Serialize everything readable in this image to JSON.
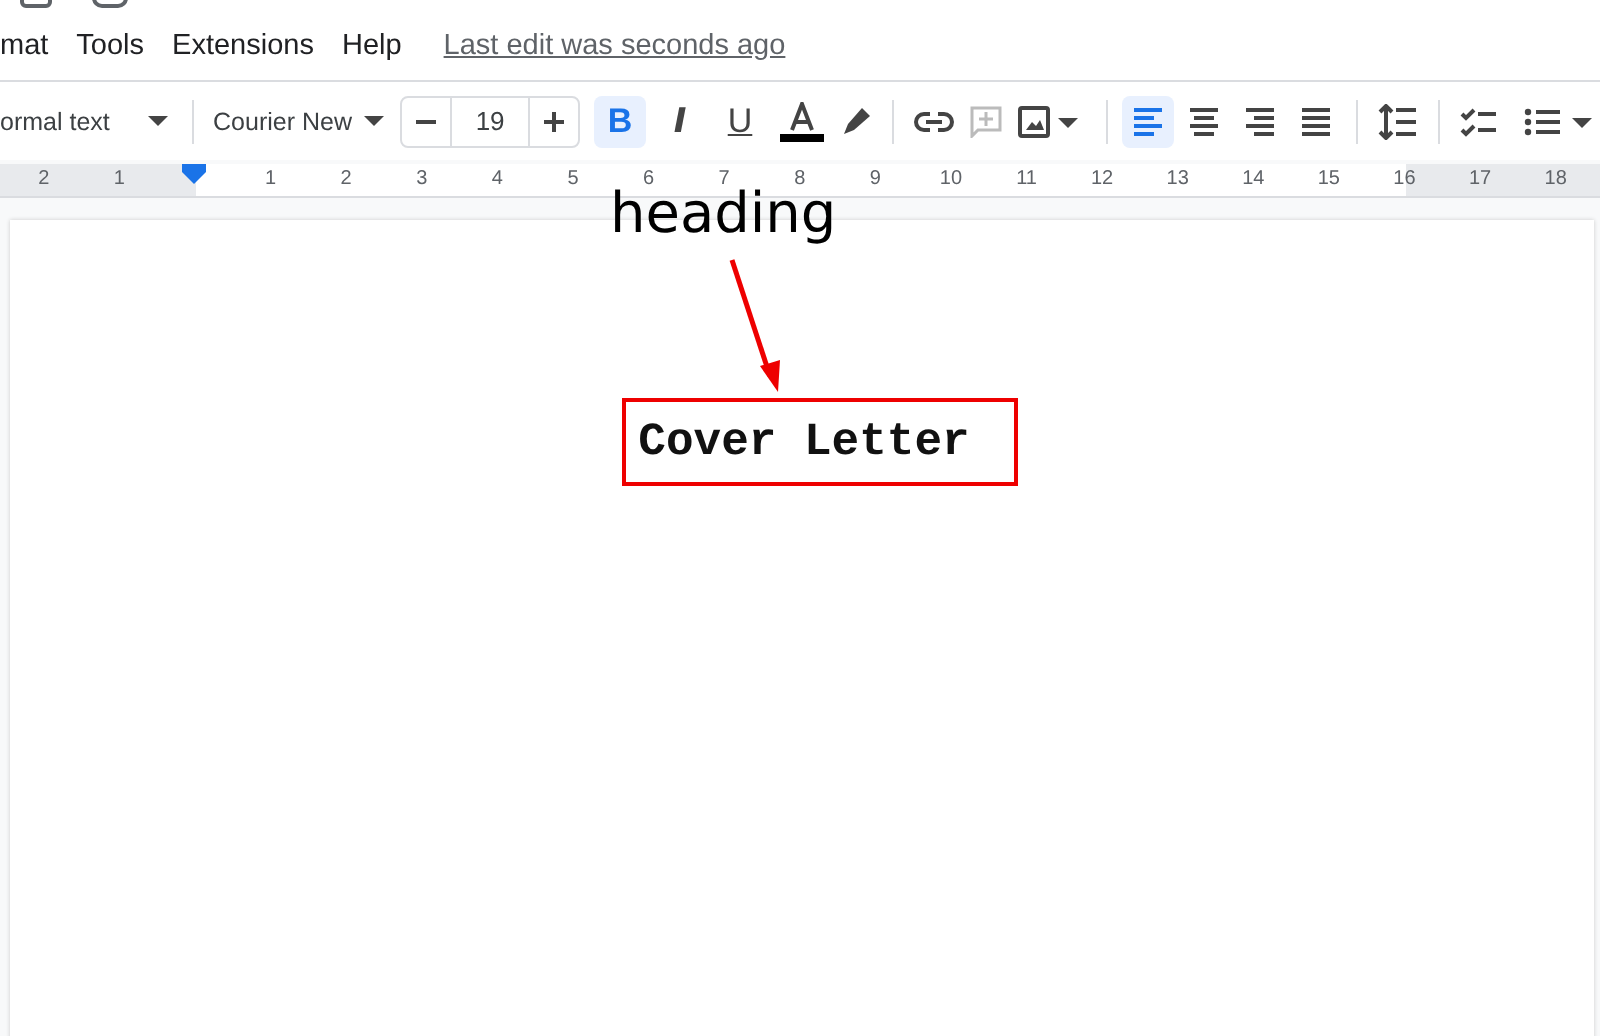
{
  "menu": [
    "mat",
    "Tools",
    "Extensions",
    "Help"
  ],
  "last_edit": "Last edit was seconds ago",
  "toolbar": {
    "style": "ormal text",
    "font": "Courier New",
    "font_size": "19",
    "format": [
      {
        "kind": "bold",
        "label": "B",
        "selected": true
      },
      {
        "kind": "italic",
        "label": "I",
        "selected": false
      },
      {
        "kind": "underline",
        "label": "U",
        "selected": false
      }
    ],
    "align": [
      {
        "kind": "left",
        "selected": true
      },
      {
        "kind": "center",
        "selected": false
      },
      {
        "kind": "right",
        "selected": false
      },
      {
        "kind": "justify",
        "selected": false
      }
    ]
  },
  "ruler": [
    {
      "kind": "number",
      "label": "2"
    },
    {
      "kind": "number",
      "label": "1"
    },
    {
      "kind": "marker"
    },
    {
      "kind": "number",
      "label": "1"
    },
    {
      "kind": "number",
      "label": "2"
    },
    {
      "kind": "number",
      "label": "3"
    },
    {
      "kind": "number",
      "label": "4"
    },
    {
      "kind": "number",
      "label": "5"
    },
    {
      "kind": "number",
      "label": "6"
    },
    {
      "kind": "number",
      "label": "7"
    },
    {
      "kind": "number",
      "label": "8"
    },
    {
      "kind": "number",
      "label": "9"
    },
    {
      "kind": "number",
      "label": "10"
    },
    {
      "kind": "number",
      "label": "11"
    },
    {
      "kind": "number",
      "label": "12"
    },
    {
      "kind": "number",
      "label": "13"
    },
    {
      "kind": "number",
      "label": "14"
    },
    {
      "kind": "number",
      "label": "15"
    },
    {
      "kind": "number",
      "label": "16"
    },
    {
      "kind": "number",
      "label": "17"
    },
    {
      "kind": "number",
      "label": "18"
    }
  ],
  "document": {
    "heading": "Cover Letter"
  },
  "annotation": {
    "label": "heading"
  }
}
